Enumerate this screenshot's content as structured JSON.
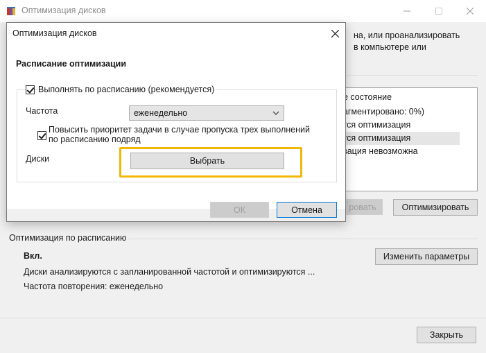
{
  "main_window": {
    "title": "Оптимизация дисков",
    "intro_lines": [
      "на, или проанализировать",
      "в компьютере или"
    ],
    "drives_list": {
      "header": "ее состояние",
      "rows": [
        {
          "text": "рагментировано: 0%)",
          "selected": false
        },
        {
          "text": "ется оптимизация",
          "selected": false
        },
        {
          "text": "ется оптимизация",
          "selected": true
        },
        {
          "text": "изация невозможна",
          "selected": false
        }
      ]
    },
    "analyze_label": "ровать",
    "optimize_label": "Оптимизировать",
    "scheduled": {
      "section_label": "Оптимизация по расписанию",
      "state": "Вкл.",
      "description": "Диски анализируются с запланированной частотой и оптимизируются ...",
      "frequency": "Частота повторения: еженедельно",
      "change_label": "Изменить параметры"
    },
    "close_label": "Закрыть"
  },
  "dialog": {
    "title": "Оптимизация дисков",
    "heading": "Расписание оптимизации",
    "run_on_schedule": {
      "label": "Выполнять по расписанию (рекомендуется)",
      "checked": true
    },
    "frequency": {
      "label": "Частота",
      "value": "еженедельно"
    },
    "priority": {
      "label": "Повысить приоритет задачи в случае пропуска трех выполнений по расписанию подряд",
      "checked": true
    },
    "disks": {
      "label": "Диски",
      "button": "Выбрать"
    },
    "ok_label": "ОК",
    "cancel_label": "Отмена"
  },
  "colors": {
    "highlight": "#f2b705",
    "default_button_border": "#0078d7"
  }
}
